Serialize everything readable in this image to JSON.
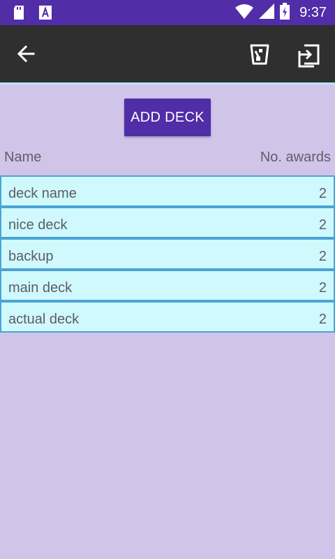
{
  "status_bar": {
    "time": "9:37",
    "icons": [
      "sd-card-icon",
      "text-icon",
      "wifi-icon",
      "signal-icon",
      "battery-charging-icon"
    ],
    "color": "#512da8"
  },
  "app_bar": {
    "color": "#2f2f2f",
    "icons": [
      "arrow-back-icon",
      "trash-icon",
      "import-icon"
    ]
  },
  "add_button": {
    "label": "ADD DECK",
    "color": "#512da8"
  },
  "columns": {
    "name": "Name",
    "awards": "No. awards"
  },
  "decks": [
    {
      "name": "deck name",
      "awards": "2"
    },
    {
      "name": "nice deck",
      "awards": "2"
    },
    {
      "name": "backup",
      "awards": "2"
    },
    {
      "name": "main deck",
      "awards": "2"
    },
    {
      "name": "actual deck",
      "awards": "2"
    }
  ],
  "colors": {
    "background": "#d1c4e9",
    "row_fill": "#cff9fd",
    "row_border": "#4aa3d6"
  }
}
